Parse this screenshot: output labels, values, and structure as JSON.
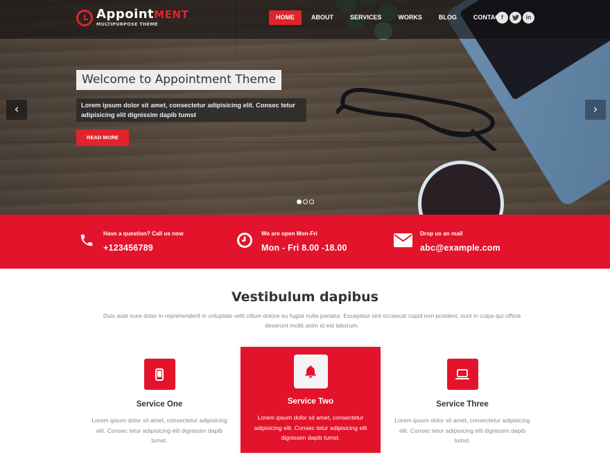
{
  "header": {
    "logo": {
      "title_main": "Appoint",
      "title_accent": "ment",
      "subtitle": "MULTIPURPOSE THEME"
    },
    "nav": [
      {
        "label": "HOME",
        "active": true
      },
      {
        "label": "ABOUT",
        "active": false
      },
      {
        "label": "SERVICES",
        "active": false
      },
      {
        "label": "WORKS",
        "active": false
      },
      {
        "label": "BLOG",
        "active": false
      },
      {
        "label": "CONTACT",
        "active": false
      }
    ],
    "social": [
      {
        "icon": "facebook-icon",
        "glyph": "f"
      },
      {
        "icon": "twitter-icon",
        "glyph": "t"
      },
      {
        "icon": "linkedin-icon",
        "glyph": "in"
      }
    ]
  },
  "slider": {
    "title": "Welcome to Appointment Theme",
    "description": "Lorem ipsum dolor sit amet, consectetur adipisicing elit. Consec tetur adipisicing elit dignissim dapib tumst",
    "button_label": "READ MORE",
    "prev_glyph": "‹",
    "next_glyph": "›",
    "slide_count": 3,
    "active_slide": 1
  },
  "infobar": [
    {
      "icon": "phone-icon",
      "label": "Have a question? Call us now",
      "value": "+123456789"
    },
    {
      "icon": "clock-icon",
      "label": "We are open Mon-Fri",
      "value": "Mon - Fri 8.00 -18.00"
    },
    {
      "icon": "envelope-icon",
      "label": "Drop us an mail",
      "value": "abc@example.com"
    }
  ],
  "services_section": {
    "title": "Vestibulum dapibus",
    "description": "Duis aute irure dolor in reprehenderit in voluptate velit cillum dolore eu fugiat nulla pariatur. Excepteur sint occaecat cupid non proident, sunt in culpa qui officia deserunt mollit anim id est laborum.",
    "items": [
      {
        "icon": "mobile-icon",
        "title": "Service One",
        "description": "Lorem ipsum dolor sit amet, consectetur adipisicing elit. Consec tetur adipisicing elit dignissim dapib tumst.",
        "featured": false
      },
      {
        "icon": "bell-icon",
        "title": "Service Two",
        "description": "Lorem ipsum dolor sit amet, consectetur adipisicing elit. Consec tetur adipisicing elit dignissim dapib tumst.",
        "featured": true
      },
      {
        "icon": "laptop-icon",
        "title": "Service Three",
        "description": "Lorem ipsum dolor sit amet, consectetur adipisicing elit. Consec tetur adipisicing elit dignissim dapib tumst.",
        "featured": false
      }
    ]
  },
  "colors": {
    "accent": "#e3132b",
    "nav_active": "#e0242b",
    "header_bg": "#120e0e",
    "text_muted": "#888888"
  }
}
